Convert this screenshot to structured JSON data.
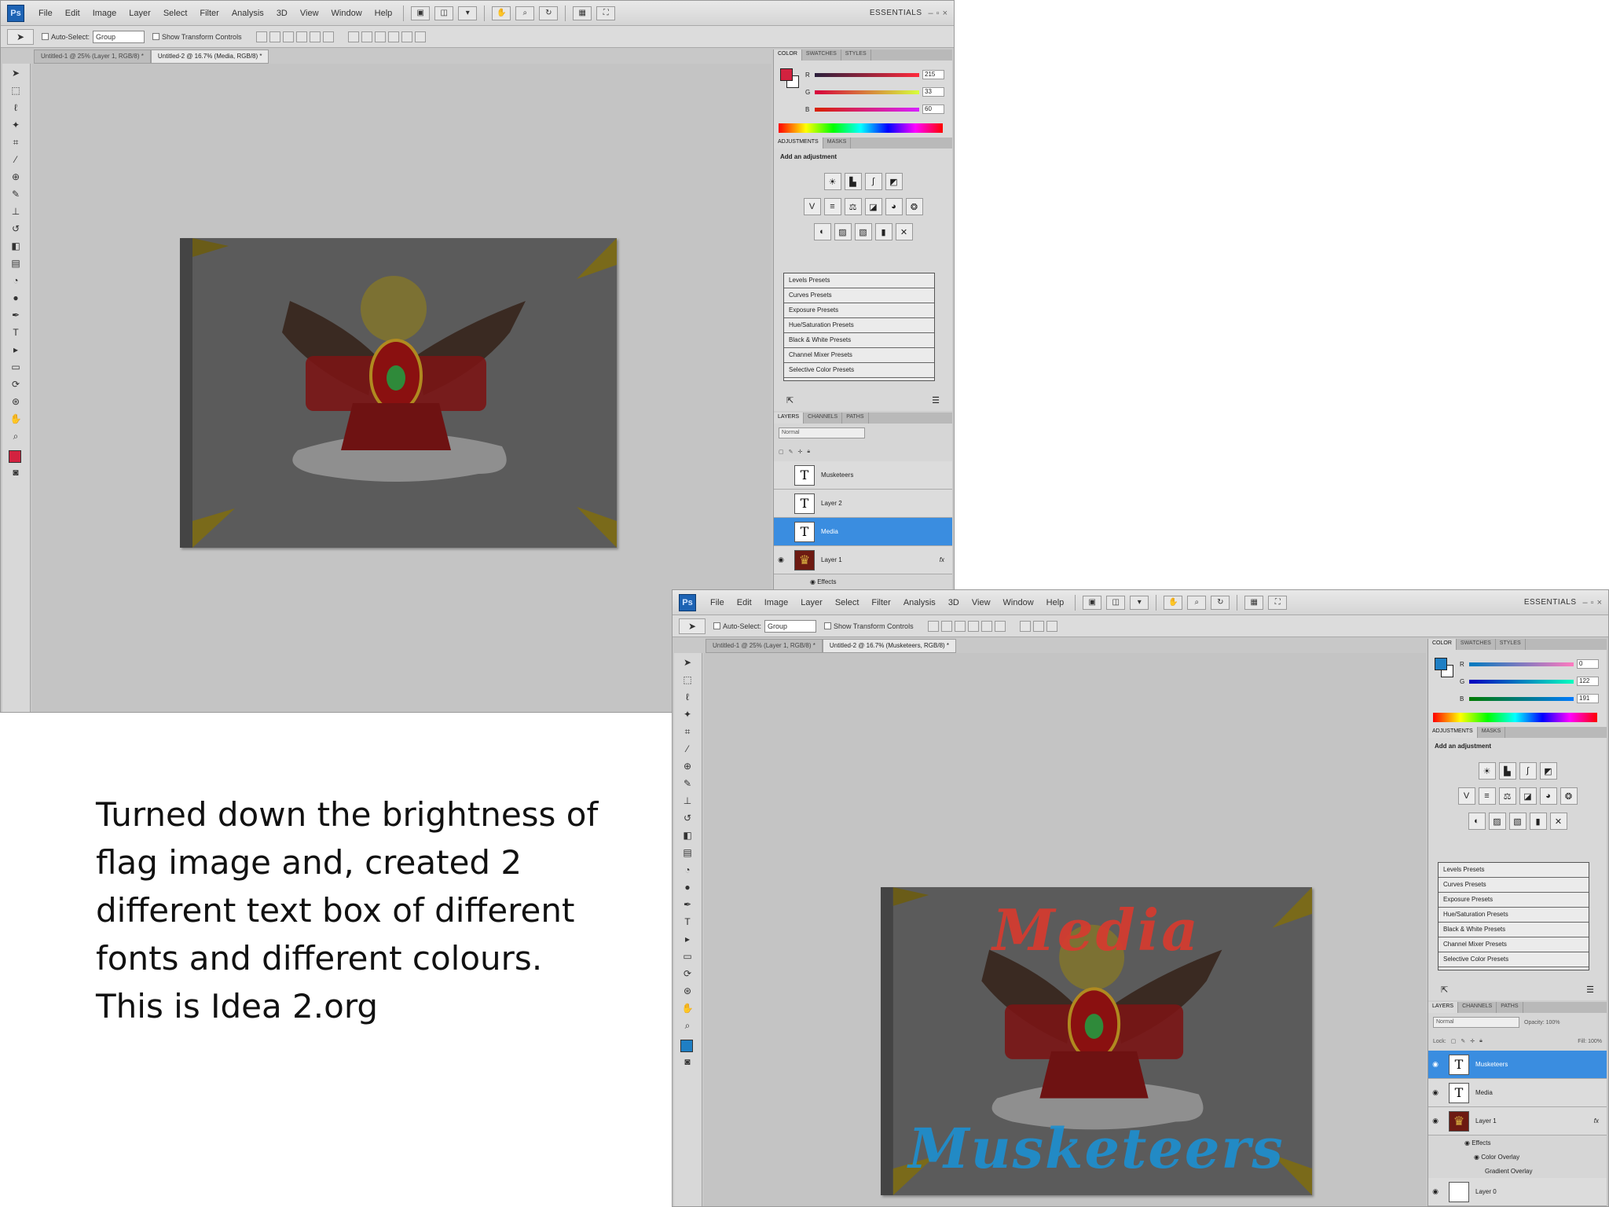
{
  "menus": [
    "File",
    "Edit",
    "Image",
    "Layer",
    "Select",
    "Filter",
    "Analysis",
    "3D",
    "View",
    "Window",
    "Help"
  ],
  "workspace": "ESSENTIALS",
  "options": {
    "auto_select": "Auto-Select:",
    "group": "Group",
    "show_transform": "Show Transform Controls"
  },
  "panel_tabs": {
    "color": [
      "COLOR",
      "SWATCHES",
      "STYLES"
    ],
    "adjust": [
      "ADJUSTMENTS",
      "MASKS"
    ],
    "layers": [
      "LAYERS",
      "CHANNELS",
      "PATHS"
    ]
  },
  "adjustments": {
    "title": "Add an adjustment",
    "presets": [
      "Levels Presets",
      "Curves Presets",
      "Exposure Presets",
      "Hue/Saturation Presets",
      "Black & White Presets",
      "Channel Mixer Presets",
      "Selective Color Presets"
    ]
  },
  "blend_mode": "Normal",
  "window1": {
    "tabs": [
      "Untitled-1 @ 25% (Layer 1, RGB/8) *",
      "Untitled-2 @ 16.7% (Media, RGB/8) *"
    ],
    "fg_color": "#d2223f",
    "rgb": {
      "r": "215",
      "g": "33",
      "b": "60"
    },
    "layers": [
      {
        "name": "Musketeers",
        "kind": "T",
        "selected": false,
        "eye": false
      },
      {
        "name": "Layer 2",
        "kind": "T",
        "selected": false,
        "eye": false
      },
      {
        "name": "Media",
        "kind": "T",
        "selected": true,
        "eye": false
      },
      {
        "name": "Layer 1",
        "kind": "img",
        "selected": false,
        "eye": true,
        "fx": "fx"
      }
    ],
    "effects_label": "Effects"
  },
  "window2": {
    "tabs": [
      "Untitled-1 @ 25% (Layer 1, RGB/8) *",
      "Untitled-2 @ 16.7% (Musketeers, RGB/8) *"
    ],
    "fg_color": "#1f7fc4",
    "rgb": {
      "r": "0",
      "g": "122",
      "b": "191"
    },
    "opacity": "Opacity: 100%",
    "fill": "Fill: 100%",
    "lock": "Lock:",
    "canvas_text_top": "Media",
    "canvas_text_bottom": "Musketeers",
    "layers": [
      {
        "name": "Musketeers",
        "kind": "T",
        "selected": true,
        "eye": true
      },
      {
        "name": "Media",
        "kind": "T",
        "selected": false,
        "eye": true
      },
      {
        "name": "Layer 1",
        "kind": "img",
        "selected": false,
        "eye": true,
        "fx": "fx"
      }
    ],
    "effects": [
      "Effects",
      "Color Overlay",
      "Gradient Overlay"
    ],
    "layer0": "Layer 0"
  },
  "caption": [
    "Turned down the brightness of",
    "flag image and, created 2",
    "different text box of different",
    "fonts and different colours.",
    "This is Idea 2.org"
  ]
}
